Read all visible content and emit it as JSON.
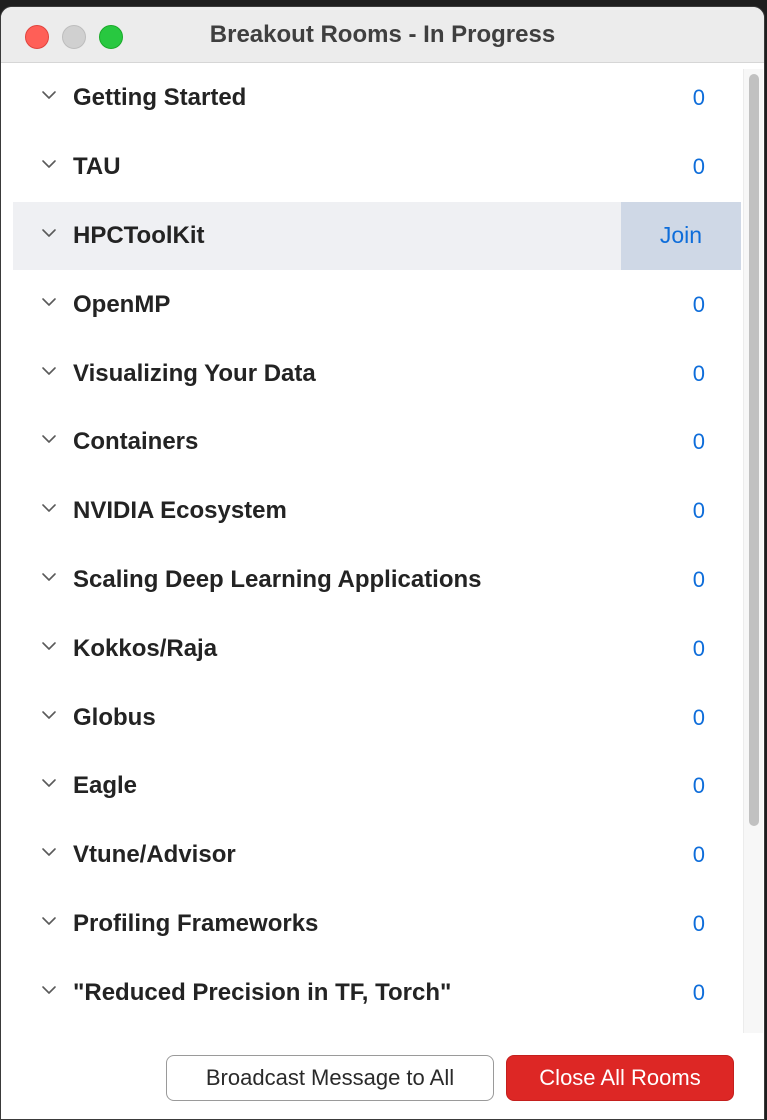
{
  "window": {
    "title": "Breakout Rooms - In Progress"
  },
  "rooms": [
    {
      "name": "Getting Started",
      "count": "0"
    },
    {
      "name": "TAU",
      "count": "0"
    },
    {
      "name": "HPCToolKit",
      "count": "",
      "action": "Join"
    },
    {
      "name": "OpenMP",
      "count": "0"
    },
    {
      "name": "Visualizing Your Data",
      "count": "0"
    },
    {
      "name": "Containers",
      "count": "0"
    },
    {
      "name": "NVIDIA Ecosystem",
      "count": "0"
    },
    {
      "name": "Scaling Deep Learning Applications",
      "count": "0"
    },
    {
      "name": "Kokkos/Raja",
      "count": "0"
    },
    {
      "name": "Globus",
      "count": "0"
    },
    {
      "name": "Eagle",
      "count": "0"
    },
    {
      "name": "Vtune/Advisor",
      "count": "0"
    },
    {
      "name": "Profiling Frameworks",
      "count": "0"
    },
    {
      "name": "\"Reduced Precision in TF, Torch\"",
      "count": "0"
    }
  ],
  "footer": {
    "broadcast_label": "Broadcast Message to All",
    "close_all_label": "Close All Rooms"
  },
  "colors": {
    "accent": "#0e6dda",
    "danger": "#dd2725",
    "hover_row": "#eff0f3",
    "join_bg": "#cfd8e6"
  },
  "icons": {
    "row_expand": "chevron-down-icon",
    "close": "close-window-icon",
    "minimize": "minimize-window-icon",
    "zoom": "zoom-window-icon"
  }
}
